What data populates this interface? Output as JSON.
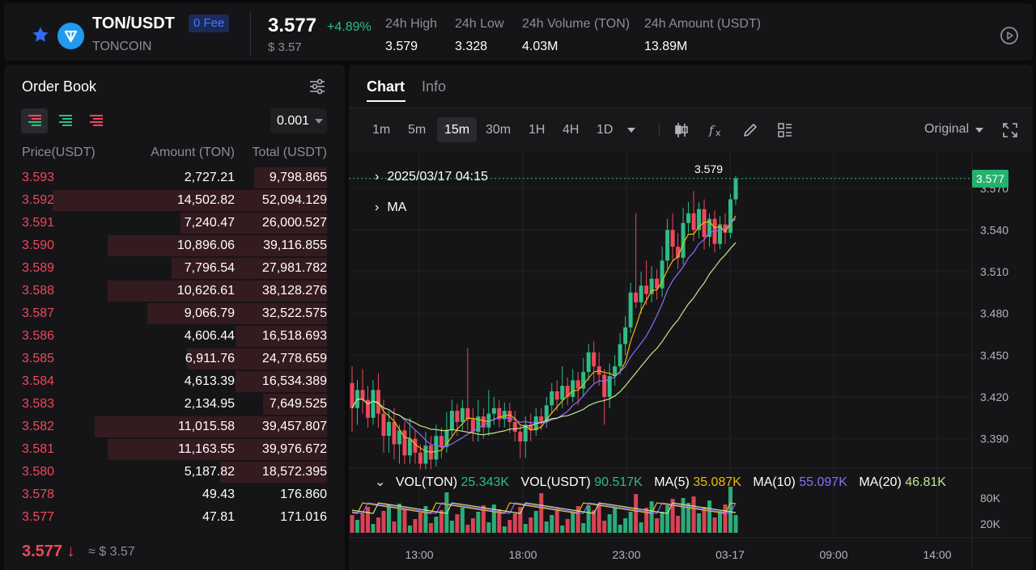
{
  "header": {
    "pair": "TON/USDT",
    "fee_badge": "0 Fee",
    "coin_name": "TONCOIN",
    "last_price": "3.577",
    "change": "+4.89%",
    "usd_price": "$ 3.57",
    "stats": [
      {
        "label": "24h High",
        "value": "3.579"
      },
      {
        "label": "24h Low",
        "value": "3.328"
      },
      {
        "label": "24h Volume (TON)",
        "value": "4.03M"
      },
      {
        "label": "24h Amount (USDT)",
        "value": "13.89M"
      }
    ],
    "icons": {
      "favorite": "star-icon",
      "logo": "ton-logo-icon",
      "play": "play-circle-icon"
    }
  },
  "orderbook": {
    "title": "Order Book",
    "precision": "0.001",
    "col_price": "Price(USDT)",
    "col_amount": "Amount (TON)",
    "col_total": "Total (USDT)",
    "asks": [
      {
        "price": "3.593",
        "amount": "2,727.21",
        "total": "9,798.865",
        "depth": 0.24
      },
      {
        "price": "3.592",
        "amount": "14,502.82",
        "total": "52,094.129",
        "depth": 0.9
      },
      {
        "price": "3.591",
        "amount": "7,240.47",
        "total": "26,000.527",
        "depth": 0.48
      },
      {
        "price": "3.590",
        "amount": "10,896.06",
        "total": "39,116.855",
        "depth": 0.72
      },
      {
        "price": "3.589",
        "amount": "7,796.54",
        "total": "27,981.782",
        "depth": 0.51
      },
      {
        "price": "3.588",
        "amount": "10,626.61",
        "total": "38,128.276",
        "depth": 0.72
      },
      {
        "price": "3.587",
        "amount": "9,066.79",
        "total": "32,522.575",
        "depth": 0.59
      },
      {
        "price": "3.586",
        "amount": "4,606.44",
        "total": "16,518.693",
        "depth": 0.3
      },
      {
        "price": "3.585",
        "amount": "6,911.76",
        "total": "24,778.659",
        "depth": 0.46
      },
      {
        "price": "3.584",
        "amount": "4,613.39",
        "total": "16,534.389",
        "depth": 0.3
      },
      {
        "price": "3.583",
        "amount": "2,134.95",
        "total": "7,649.525",
        "depth": 0.21
      },
      {
        "price": "3.582",
        "amount": "11,015.58",
        "total": "39,457.807",
        "depth": 0.76
      },
      {
        "price": "3.581",
        "amount": "11,163.55",
        "total": "39,976.672",
        "depth": 0.72
      },
      {
        "price": "3.580",
        "amount": "5,187.82",
        "total": "18,572.395",
        "depth": 0.35
      },
      {
        "price": "3.578",
        "amount": "49.43",
        "total": "176.860",
        "depth": 0
      },
      {
        "price": "3.577",
        "amount": "47.81",
        "total": "171.016",
        "depth": 0
      }
    ],
    "last_price": "3.577",
    "last_arrow": "↓",
    "last_usd": "≈ $ 3.57"
  },
  "chart_panel": {
    "tabs": [
      {
        "label": "Chart",
        "active": true
      },
      {
        "label": "Info",
        "active": false
      }
    ],
    "timeframes": [
      "1m",
      "5m",
      "15m",
      "30m",
      "1H",
      "4H",
      "1D"
    ],
    "active_timeframe": "15m",
    "view_mode": "Original",
    "icons": [
      "candlestick-icon",
      "fx-indicator-icon",
      "pencil-icon",
      "layout-icon",
      "fullscreen-icon"
    ],
    "overlay_date": "2025/03/17 04:15",
    "overlay_ma": "MA",
    "high_label": "3.579",
    "current_price_tag": "3.577",
    "vol_legend": [
      {
        "label": "VOL(TON)",
        "value": "25.343K",
        "color": "#2ebd85"
      },
      {
        "label": "VOL(USDT)",
        "value": "90.517K",
        "color": "#2ebd85"
      },
      {
        "label": "MA(5)",
        "value": "35.087K",
        "color": "#f0b90b"
      },
      {
        "label": "MA(10)",
        "value": "55.097K",
        "color": "#8c6cff"
      },
      {
        "label": "MA(20)",
        "value": "46.81K",
        "color": "#c3e68f"
      }
    ]
  },
  "chart_data": {
    "type": "candlestick",
    "y_ticks": [
      "3.570",
      "3.540",
      "3.510",
      "3.480",
      "3.450",
      "3.420",
      "3.390"
    ],
    "y_range": [
      3.37,
      3.585
    ],
    "volume_ticks": [
      "80K",
      "20K"
    ],
    "x_ticks": [
      "13:00",
      "18:00",
      "23:00",
      "03-17",
      "09:00",
      "14:00"
    ],
    "candles": [
      [
        3.43,
        3.412,
        3.442,
        3.395
      ],
      [
        3.412,
        3.425,
        3.432,
        3.4
      ],
      [
        3.425,
        3.418,
        3.44,
        3.408
      ],
      [
        3.418,
        3.405,
        3.428,
        3.398
      ],
      [
        3.405,
        3.425,
        3.432,
        3.4
      ],
      [
        3.425,
        3.408,
        3.437,
        3.398
      ],
      [
        3.408,
        3.392,
        3.418,
        3.38
      ],
      [
        3.392,
        3.402,
        3.41,
        3.38
      ],
      [
        3.402,
        3.386,
        3.412,
        3.375
      ],
      [
        3.386,
        3.396,
        3.4,
        3.372
      ],
      [
        3.396,
        3.378,
        3.402,
        3.372
      ],
      [
        3.378,
        3.39,
        3.405,
        3.372
      ],
      [
        3.39,
        3.38,
        3.396,
        3.372
      ],
      [
        3.38,
        3.372,
        3.386,
        3.368
      ],
      [
        3.372,
        3.385,
        3.395,
        3.368
      ],
      [
        3.385,
        3.375,
        3.392,
        3.368
      ],
      [
        3.375,
        3.392,
        3.4,
        3.37
      ],
      [
        3.392,
        3.384,
        3.398,
        3.376
      ],
      [
        3.384,
        3.396,
        3.409,
        3.38
      ],
      [
        3.396,
        3.41,
        3.418,
        3.392
      ],
      [
        3.41,
        3.402,
        3.415,
        3.392
      ],
      [
        3.402,
        3.412,
        3.418,
        3.396
      ],
      [
        3.412,
        3.404,
        3.455,
        3.396
      ],
      [
        3.404,
        3.395,
        3.412,
        3.388
      ],
      [
        3.395,
        3.406,
        3.418,
        3.388
      ],
      [
        3.406,
        3.398,
        3.412,
        3.39
      ],
      [
        3.398,
        3.408,
        3.425,
        3.392
      ],
      [
        3.408,
        3.412,
        3.42,
        3.4
      ],
      [
        3.412,
        3.404,
        3.418,
        3.398
      ],
      [
        3.404,
        3.41,
        3.416,
        3.398
      ],
      [
        3.41,
        3.402,
        3.416,
        3.394
      ],
      [
        3.402,
        3.395,
        3.41,
        3.388
      ],
      [
        3.395,
        3.388,
        3.4,
        3.376
      ],
      [
        3.388,
        3.4,
        3.406,
        3.376
      ],
      [
        3.4,
        3.396,
        3.408,
        3.388
      ],
      [
        3.396,
        3.406,
        3.412,
        3.392
      ],
      [
        3.406,
        3.402,
        3.412,
        3.396
      ],
      [
        3.402,
        3.414,
        3.42,
        3.398
      ],
      [
        3.414,
        3.424,
        3.43,
        3.408
      ],
      [
        3.424,
        3.418,
        3.432,
        3.41
      ],
      [
        3.418,
        3.428,
        3.442,
        3.412
      ],
      [
        3.428,
        3.42,
        3.434,
        3.414
      ],
      [
        3.42,
        3.432,
        3.44,
        3.416
      ],
      [
        3.432,
        3.426,
        3.438,
        3.414
      ],
      [
        3.426,
        3.438,
        3.448,
        3.42
      ],
      [
        3.438,
        3.452,
        3.458,
        3.432
      ],
      [
        3.452,
        3.442,
        3.46,
        3.43
      ],
      [
        3.442,
        3.436,
        3.452,
        3.428
      ],
      [
        3.436,
        3.42,
        3.44,
        3.4
      ],
      [
        3.42,
        3.435,
        3.444,
        3.412
      ],
      [
        3.435,
        3.442,
        3.45,
        3.428
      ],
      [
        3.442,
        3.458,
        3.466,
        3.436
      ],
      [
        3.458,
        3.47,
        3.478,
        3.45
      ],
      [
        3.47,
        3.495,
        3.502,
        3.466
      ],
      [
        3.495,
        3.488,
        3.552,
        3.484
      ],
      [
        3.488,
        3.5,
        3.51,
        3.48
      ],
      [
        3.5,
        3.494,
        3.518,
        3.486
      ],
      [
        3.494,
        3.505,
        3.514,
        3.488
      ],
      [
        3.505,
        3.498,
        3.512,
        3.49
      ],
      [
        3.498,
        3.518,
        3.528,
        3.492
      ],
      [
        3.518,
        3.54,
        3.548,
        3.512
      ],
      [
        3.54,
        3.528,
        3.552,
        3.518
      ],
      [
        3.528,
        3.52,
        3.538,
        3.512
      ],
      [
        3.52,
        3.545,
        3.556,
        3.515
      ],
      [
        3.545,
        3.552,
        3.56,
        3.538
      ],
      [
        3.552,
        3.54,
        3.568,
        3.532
      ],
      [
        3.54,
        3.555,
        3.56,
        3.534
      ],
      [
        3.555,
        3.535,
        3.562,
        3.526
      ],
      [
        3.535,
        3.548,
        3.552,
        3.528
      ],
      [
        3.548,
        3.53,
        3.554,
        3.524
      ],
      [
        3.53,
        3.544,
        3.55,
        3.526
      ],
      [
        3.544,
        3.538,
        3.552,
        3.53
      ],
      [
        3.538,
        3.562,
        3.566,
        3.534
      ],
      [
        3.562,
        3.577,
        3.579,
        3.558
      ]
    ]
  }
}
